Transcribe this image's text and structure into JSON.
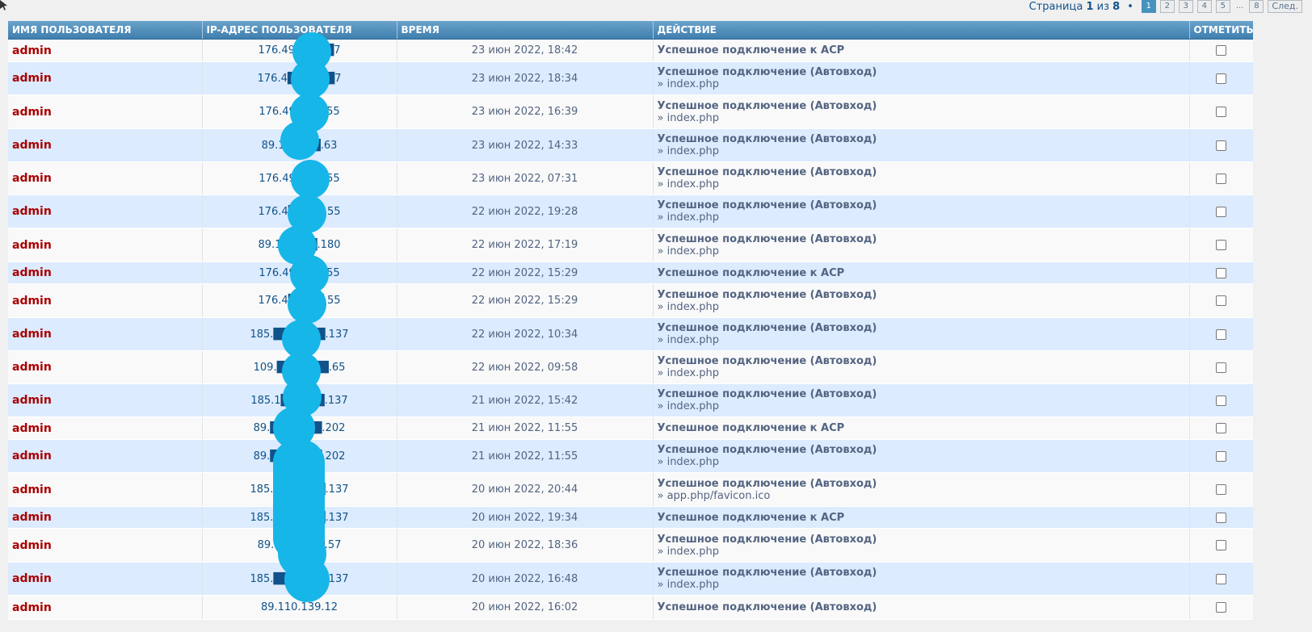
{
  "pagination": {
    "label": "Страница",
    "current": "1",
    "of": "из",
    "total": "8",
    "pages": [
      "1",
      "2",
      "3",
      "4",
      "5"
    ],
    "ellipsis": "...",
    "last": "8",
    "next_label": "След."
  },
  "table": {
    "columns": [
      "ИМЯ ПОЛЬЗОВАТЕЛЯ",
      "IP-АДРЕС ПОЛЬЗОВАТЕЛЯ",
      "ВРЕМЯ",
      "ДЕЙСТВИЕ",
      "ОТМЕТИТЬ"
    ],
    "rows": [
      {
        "user": "admin",
        "ip": "176.49.███.█7",
        "time": "23 июн 2022, 18:42",
        "action": "Успешное подключение к АСР",
        "sub": ""
      },
      {
        "user": "admin",
        "ip": "176.4█.███.█7",
        "time": "23 июн 2022, 18:34",
        "action": "Успешное подключение (Автовход)",
        "sub": "» index.php"
      },
      {
        "user": "admin",
        "ip": "176.49.███.55",
        "time": "23 июн 2022, 16:39",
        "action": "Успешное подключение (Автовход)",
        "sub": "» index.php"
      },
      {
        "user": "admin",
        "ip": "89.1█.███.63",
        "time": "23 июн 2022, 14:33",
        "action": "Успешное подключение (Автовход)",
        "sub": "» index.php"
      },
      {
        "user": "admin",
        "ip": "176.49.███.55",
        "time": "23 июн 2022, 07:31",
        "action": "Успешное подключение (Автовход)",
        "sub": "» index.php"
      },
      {
        "user": "admin",
        "ip": "176.4█.███.55",
        "time": "22 июн 2022, 19:28",
        "action": "Успешное подключение (Автовход)",
        "sub": "» index.php"
      },
      {
        "user": "admin",
        "ip": "89.1█.███.180",
        "time": "22 июн 2022, 17:19",
        "action": "Успешное подключение (Автовход)",
        "sub": "» index.php"
      },
      {
        "user": "admin",
        "ip": "176.49.███.55",
        "time": "22 июн 2022, 15:29",
        "action": "Успешное подключение к АСР",
        "sub": ""
      },
      {
        "user": "admin",
        "ip": "176.4█.███.55",
        "time": "22 июн 2022, 15:29",
        "action": "Успешное подключение (Автовход)",
        "sub": "» index.php"
      },
      {
        "user": "admin",
        "ip": "185.███.███.137",
        "time": "22 июн 2022, 10:34",
        "action": "Успешное подключение (Автовход)",
        "sub": "» index.php"
      },
      {
        "user": "admin",
        "ip": "109.███.███.65",
        "time": "22 июн 2022, 09:58",
        "action": "Успешное подключение (Автовход)",
        "sub": "» index.php"
      },
      {
        "user": "admin",
        "ip": "185.1██.███.137",
        "time": "21 июн 2022, 15:42",
        "action": "Успешное подключение (Автовход)",
        "sub": "» index.php"
      },
      {
        "user": "admin",
        "ip": "89.███.███.202",
        "time": "21 июн 2022, 11:55",
        "action": "Успешное подключение к АСР",
        "sub": ""
      },
      {
        "user": "admin",
        "ip": "89.███.███.202",
        "time": "21 июн 2022, 11:55",
        "action": "Успешное подключение (Автовход)",
        "sub": "» index.php"
      },
      {
        "user": "admin",
        "ip": "185.███.███.137",
        "time": "20 июн 2022, 20:44",
        "action": "Успешное подключение (Автовход)",
        "sub": "» app.php/favicon.ico"
      },
      {
        "user": "admin",
        "ip": "185.███.███.137",
        "time": "20 июн 2022, 19:34",
        "action": "Успешное подключение к АСР",
        "sub": ""
      },
      {
        "user": "admin",
        "ip": "89.1██.███.57",
        "time": "20 июн 2022, 18:36",
        "action": "Успешное подключение (Автовход)",
        "sub": "» index.php"
      },
      {
        "user": "admin",
        "ip": "185.███.███.137",
        "time": "20 июн 2022, 16:48",
        "action": "Успешное подключение (Автовход)",
        "sub": "» index.php"
      },
      {
        "user": "admin",
        "ip": "89.110.139.12",
        "time": "20 июн 2022, 16:02",
        "action": "Успешное подключение (Автовход)",
        "sub": ""
      }
    ]
  },
  "colors": {
    "header_bg": "#4f8cbb",
    "row_alt_bg": "#dcebfe",
    "username": "#aa0000",
    "link": "#105289",
    "redaction": "#17b6e8"
  }
}
